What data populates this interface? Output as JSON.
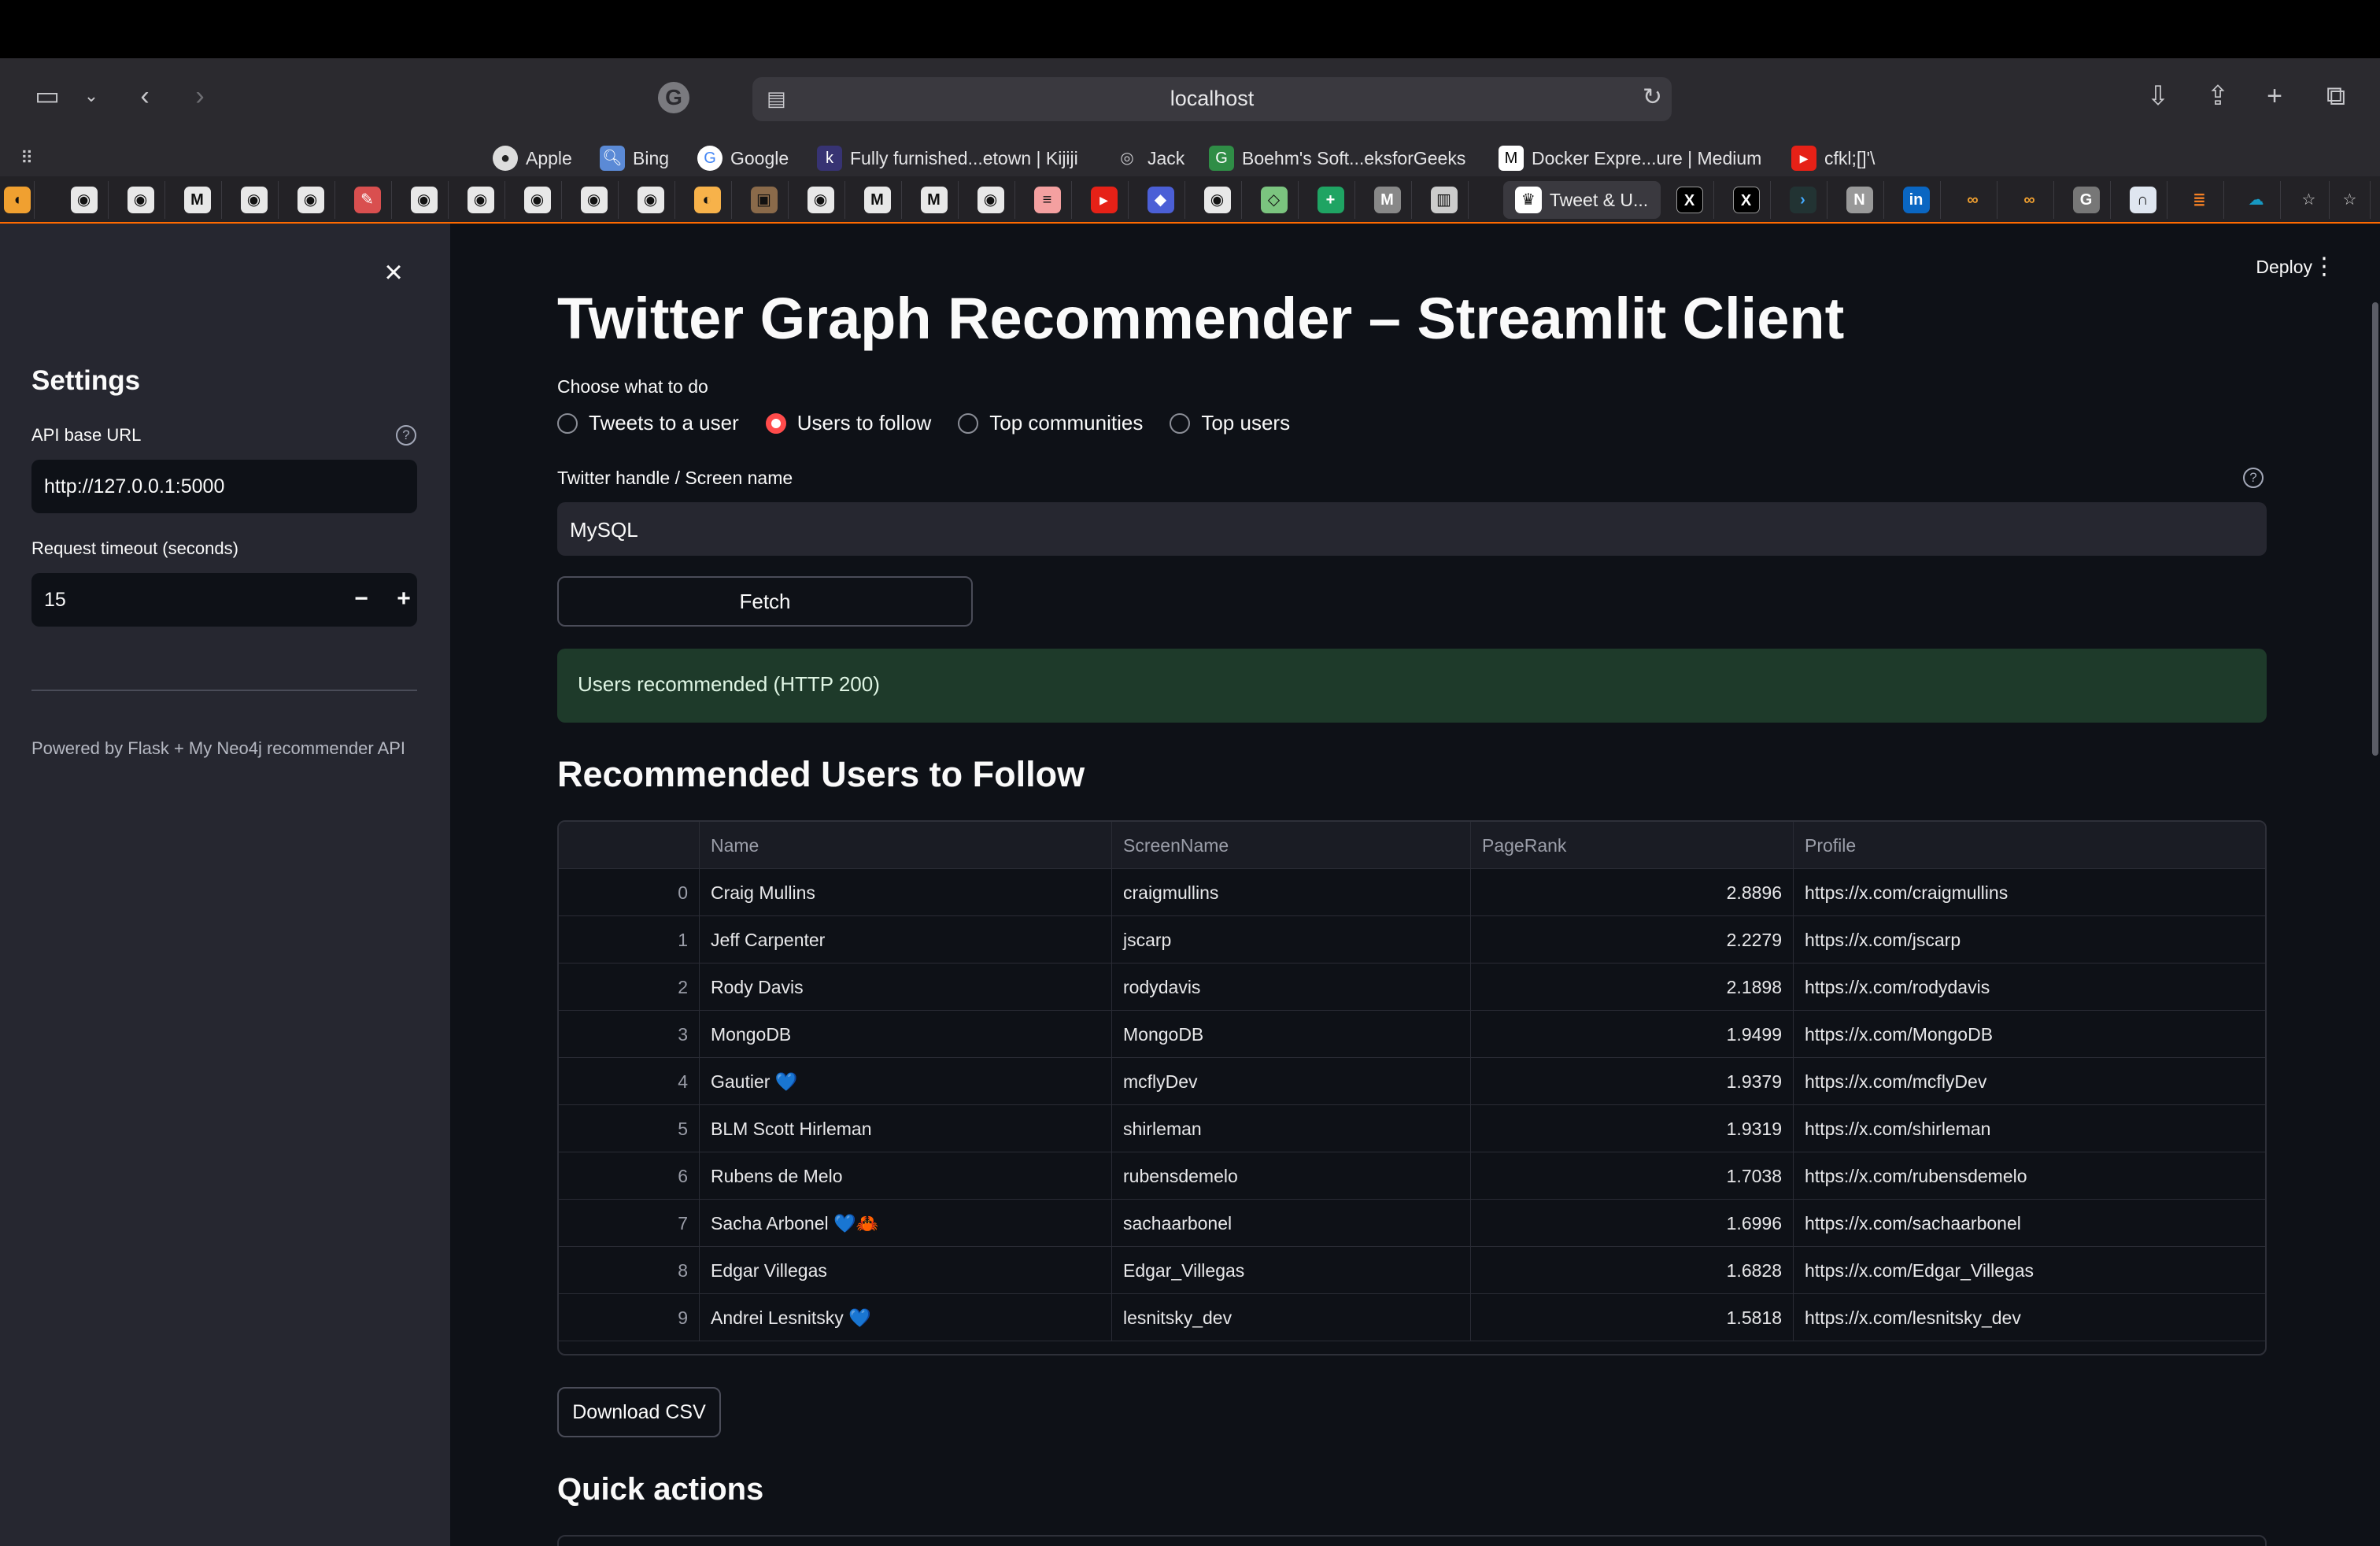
{
  "browser": {
    "url": "localhost",
    "favorites": [
      {
        "label": "Apple",
        "icon": "apple-icon"
      },
      {
        "label": "Bing",
        "icon": "bing-icon"
      },
      {
        "label": "Google",
        "icon": "google-icon"
      },
      {
        "label": "Fully furnished...etown | Kijiji",
        "icon": "kijiji-icon"
      },
      {
        "label": "Jack",
        "icon": "globe-icon"
      },
      {
        "label": "Boehm's Soft...eksforGeeks",
        "icon": "geeksforgeeks-icon"
      },
      {
        "label": "Docker Expre...ure | Medium",
        "icon": "medium-icon"
      },
      {
        "label": "cfkl;[]'\\",
        "icon": "youtube-icon"
      }
    ],
    "active_tab": "Tweet & U..."
  },
  "sidebar": {
    "title": "Settings",
    "api_label": "API base URL",
    "api_value": "http://127.0.0.1:5000",
    "timeout_label": "Request timeout (seconds)",
    "timeout_value": "15",
    "minus": "−",
    "plus": "+",
    "footer": "Powered by Flask + My Neo4j recommender API"
  },
  "header": {
    "deploy": "Deploy"
  },
  "main": {
    "title": "Twitter Graph Recommender – Streamlit Client",
    "choose_label": "Choose what to do",
    "options": [
      "Tweets to a user",
      "Users to follow",
      "Top communities",
      "Top users"
    ],
    "selected_option": "Users to follow",
    "handle_label": "Twitter handle / Screen name",
    "handle_value": "MySQL",
    "fetch_label": "Fetch",
    "status": "Users recommended (HTTP 200)",
    "section_title": "Recommended Users to Follow",
    "download_label": "Download CSV",
    "quick_actions": "Quick actions"
  },
  "table": {
    "columns": [
      "",
      "Name",
      "ScreenName",
      "PageRank",
      "Profile"
    ],
    "rows": [
      [
        "0",
        "Craig Mullins",
        "craigmullins",
        "2.8896",
        "https://x.com/craigmullins"
      ],
      [
        "1",
        "Jeff Carpenter",
        "jscarp",
        "2.2279",
        "https://x.com/jscarp"
      ],
      [
        "2",
        "Rody Davis",
        "rodydavis",
        "2.1898",
        "https://x.com/rodydavis"
      ],
      [
        "3",
        "MongoDB",
        "MongoDB",
        "1.9499",
        "https://x.com/MongoDB"
      ],
      [
        "4",
        "Gautier 💙",
        "mcflyDev",
        "1.9379",
        "https://x.com/mcflyDev"
      ],
      [
        "5",
        "BLM Scott Hirleman",
        "shirleman",
        "1.9319",
        "https://x.com/shirleman"
      ],
      [
        "6",
        "Rubens de Melo",
        "rubensdemelo",
        "1.7038",
        "https://x.com/rubensdemelo"
      ],
      [
        "7",
        "Sacha Arbonel 💙🦀",
        "sachaarbonel",
        "1.6996",
        "https://x.com/sachaarbonel"
      ],
      [
        "8",
        "Edgar Villegas",
        "Edgar_Villegas",
        "1.6828",
        "https://x.com/Edgar_Villegas"
      ],
      [
        "9",
        "Andrei Lesnitsky 💙",
        "lesnitsky_dev",
        "1.5818",
        "https://x.com/lesnitsky_dev"
      ]
    ]
  }
}
